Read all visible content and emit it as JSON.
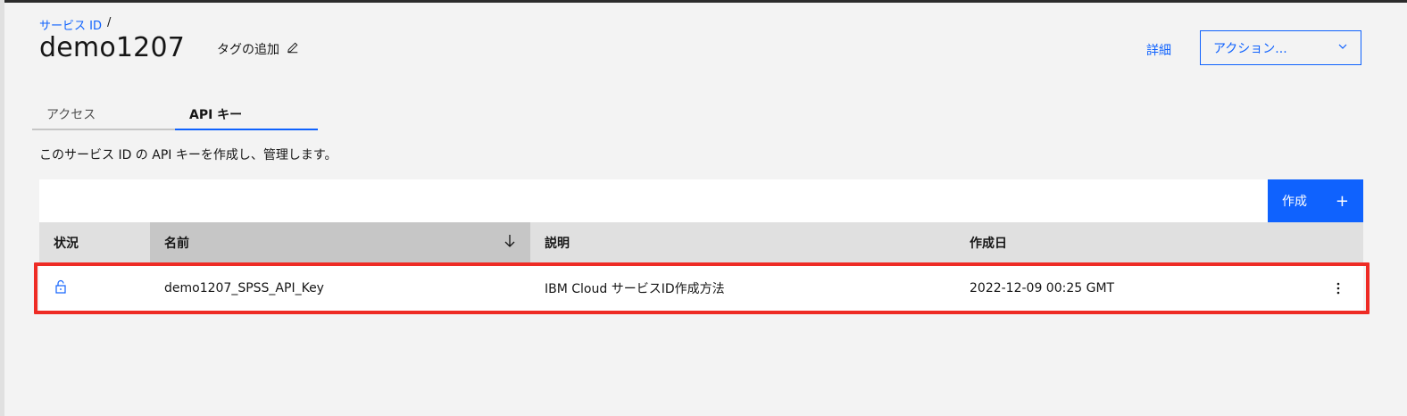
{
  "breadcrumb": {
    "link": "サービス ID",
    "separator": "/"
  },
  "header": {
    "title": "demo1207",
    "add_tag": "タグの追加",
    "details": "詳細",
    "actions": "アクション..."
  },
  "tabs": [
    {
      "label": "アクセス",
      "active": false
    },
    {
      "label": "API キー",
      "active": true
    }
  ],
  "description": "このサービス ID の API キーを作成し、管理します。",
  "toolbar": {
    "create_label": "作成",
    "create_icon": "+"
  },
  "table": {
    "columns": [
      "状況",
      "名前",
      "説明",
      "作成日"
    ],
    "sorted_column": "名前",
    "rows": [
      {
        "status_icon": "unlocked-icon",
        "name": "demo1207_SPSS_API_Key",
        "description": "IBM Cloud サービスID作成方法",
        "created": "2022-12-09 00:25 GMT"
      }
    ]
  },
  "colors": {
    "accent": "#0f62fe",
    "highlight": "#ee2b24",
    "background": "#f3f3f3"
  }
}
